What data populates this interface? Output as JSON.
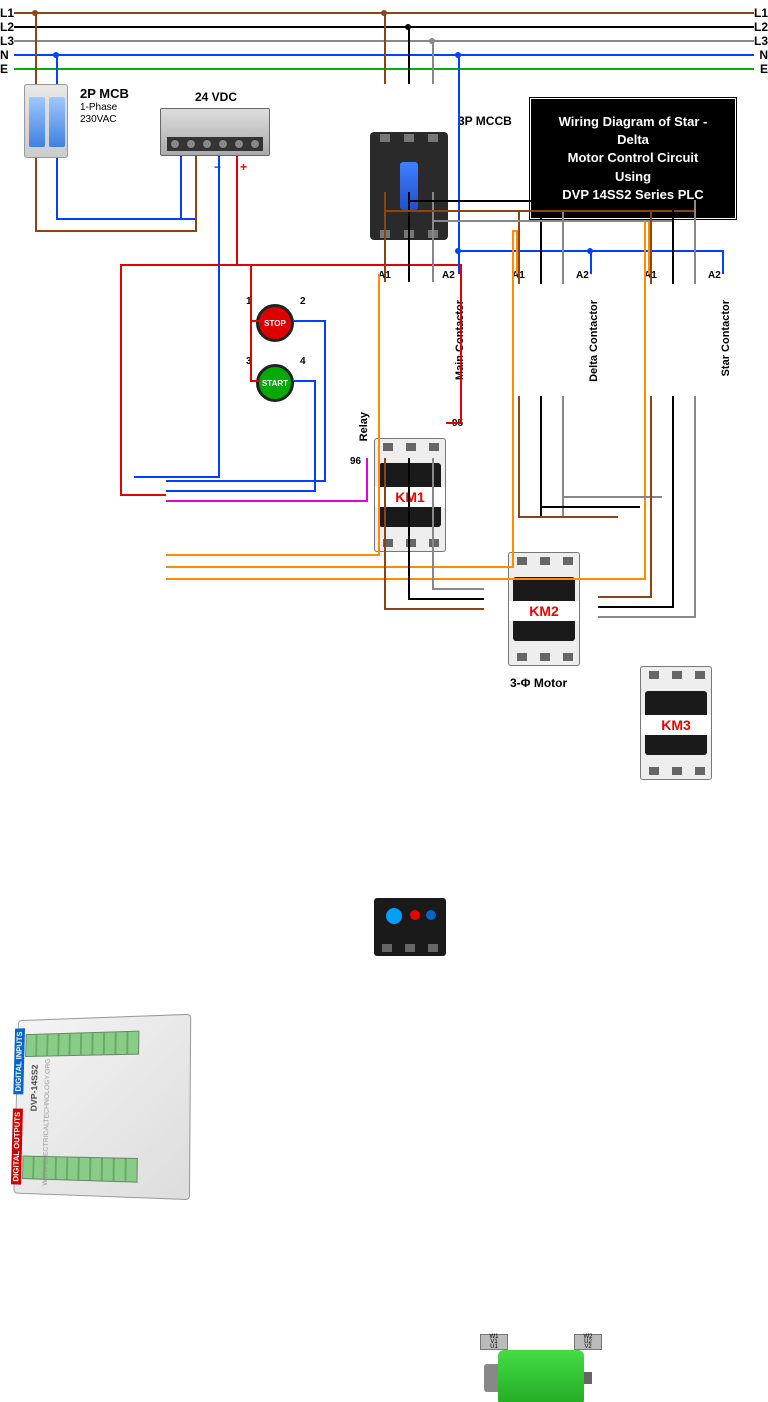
{
  "title": {
    "line1": "Wiring Diagram of Star - Delta",
    "line2": "Motor Control Circuit Using",
    "line3": "DVP 14SS2 Series PLC"
  },
  "supply_lines": {
    "L1": "L1",
    "L2": "L2",
    "L3": "L3",
    "N": "N",
    "E": "E"
  },
  "components": {
    "mcb": {
      "name": "2P MCB",
      "phase": "1-Phase",
      "voltage": "230VAC"
    },
    "psu": {
      "name": "24 VDC",
      "neg": "−",
      "pos": "+"
    },
    "mccb": {
      "name": "3P MCCB"
    },
    "stop_btn": {
      "label": "STOP",
      "term1": "1",
      "term2": "2"
    },
    "start_btn": {
      "label": "START",
      "term3": "3",
      "term4": "4"
    },
    "km1": {
      "id": "KM1",
      "role": "Main Contactor",
      "a1": "A1",
      "a2": "A2"
    },
    "km2": {
      "id": "KM2",
      "role": "Delta Contactor",
      "a1": "A1",
      "a2": "A2"
    },
    "km3": {
      "id": "KM3",
      "role": "Star Contactor",
      "a1": "A1",
      "a2": "A2"
    },
    "overload": {
      "name": "Relay",
      "t95": "95",
      "t96": "96"
    },
    "plc": {
      "model": "DVP-14SS2",
      "inputs_label": "DIGITAL INPUTS",
      "outputs_label": "DIGITAL OUTPUTS",
      "watermark": "WWW.ELECTRICALTECHNOLOGY.ORG"
    },
    "motor": {
      "name": "3-Φ Motor",
      "left_terms": {
        "w1": "W1",
        "v1": "V1",
        "u1": "U1"
      },
      "right_terms": {
        "w2": "W2",
        "u2": "U2",
        "v2": "V2"
      }
    }
  },
  "wire_colors": {
    "L1": "#8b4513",
    "L2": "#000000",
    "L3": "#888888",
    "N": "#0040ff",
    "E": "#00b000",
    "plc_out": "#ff8c00",
    "dc_pos": "#e00000",
    "dc_neg": "#0040ff",
    "relay_sig": "#e000e0"
  }
}
